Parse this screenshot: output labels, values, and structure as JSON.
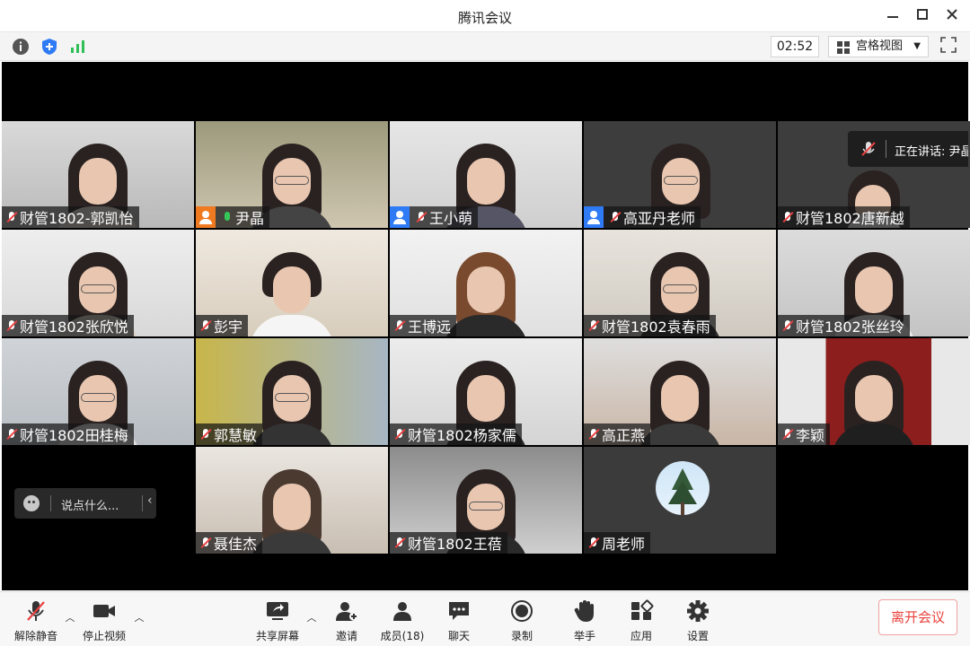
{
  "window": {
    "title": "腾讯会议"
  },
  "toolbar": {
    "timer": "02:52",
    "view_label": "宫格视图",
    "icons": [
      "info-icon",
      "shield-icon",
      "signal-icon",
      "grid-view-icon",
      "fullscreen-icon"
    ]
  },
  "speaking": {
    "label": "正在讲话: 尹晶"
  },
  "chat": {
    "placeholder": "说点什么..."
  },
  "participants": [
    {
      "name": "财管1802-郭凯怡",
      "mic": "muted"
    },
    {
      "name": "尹晶",
      "mic": "on",
      "role": "host"
    },
    {
      "name": "王小萌",
      "mic": "muted",
      "role": "cohost"
    },
    {
      "name": "高亚丹老师",
      "mic": "muted",
      "role": "cohost"
    },
    {
      "name": "财管1802唐新越",
      "mic": "muted"
    },
    {
      "name": "财管1802张欣悦",
      "mic": "muted"
    },
    {
      "name": "彭宇",
      "mic": "muted"
    },
    {
      "name": "王博远",
      "mic": "muted"
    },
    {
      "name": "财管1802袁春雨",
      "mic": "muted"
    },
    {
      "name": "财管1802张丝玲",
      "mic": "muted"
    },
    {
      "name": "财管1802田桂梅",
      "mic": "muted"
    },
    {
      "name": "郭慧敏",
      "mic": "muted"
    },
    {
      "name": "财管1802杨家儒",
      "mic": "muted"
    },
    {
      "name": "高正燕",
      "mic": "muted"
    },
    {
      "name": "李颖",
      "mic": "muted"
    },
    {
      "name": "聂佳杰",
      "mic": "muted"
    },
    {
      "name": "财管1802王蓓",
      "mic": "muted"
    },
    {
      "name": "周老师",
      "mic": "muted"
    }
  ],
  "controls": {
    "mute": "解除静音",
    "video": "停止视频",
    "share": "共享屏幕",
    "invite": "邀请",
    "members": "成员(18)",
    "chat": "聊天",
    "record": "录制",
    "raise_hand": "举手",
    "apps": "应用",
    "settings": "设置",
    "leave": "离开会议"
  },
  "colors": {
    "host_badge": "#f07a1f",
    "cohost_badge": "#2f7bf5",
    "active_speaker_border": "#2fbf57",
    "leave_text": "#e8403a",
    "muted_slash": "#e84040"
  }
}
